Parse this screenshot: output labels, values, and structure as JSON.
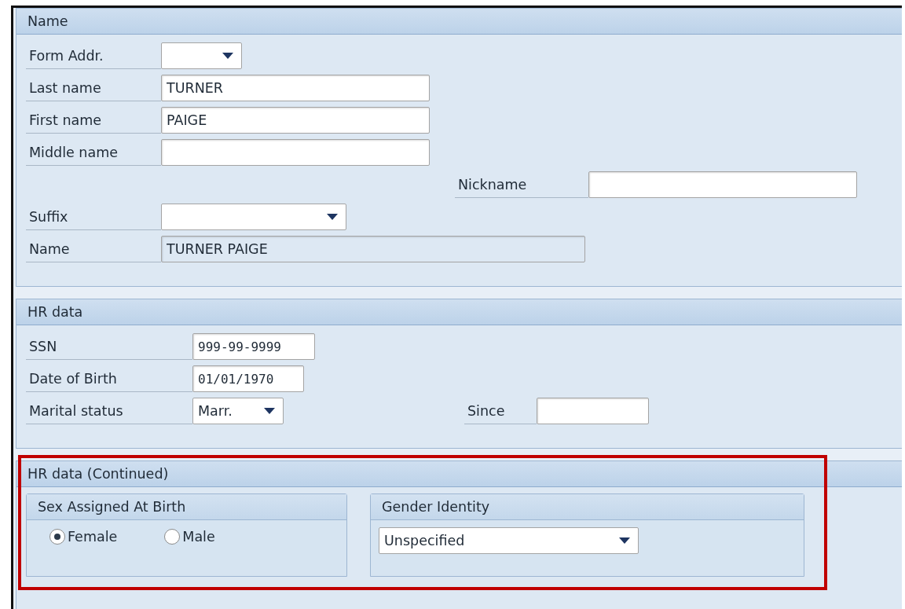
{
  "sections": [
    {
      "title": "Name",
      "rows": [
        [
          {
            "label": "Form Addr.",
            "kind": "dropdown"
          }
        ],
        [
          {
            "label": "Last name",
            "kind": "text",
            "value": "TURNER"
          }
        ],
        [
          {
            "label": "First name",
            "kind": "text",
            "value": "PAIGE"
          }
        ],
        [
          {
            "label": "Middle name",
            "kind": "text"
          }
        ],
        [
          {
            "label": "Nickname",
            "kind": "text"
          }
        ],
        [
          {
            "label": "Suffix",
            "kind": "dropdown"
          }
        ],
        [
          {
            "label": "Name",
            "kind": "readonly",
            "value": "TURNER PAIGE"
          }
        ]
      ]
    },
    {
      "title": "HR data",
      "rows": [
        [
          {
            "label": "SSN",
            "kind": "mono",
            "value": "999-99-9999"
          }
        ],
        [
          {
            "label": "Date of Birth",
            "kind": "mono",
            "value": "01/01/1970"
          }
        ],
        [
          {
            "label": "Marital status",
            "kind": "dropdown",
            "value": "Marr."
          },
          {
            "label": "Since",
            "kind": "text"
          }
        ]
      ]
    },
    {
      "title": "HR data (Continued)",
      "highlighted": true,
      "sex_assigned_at_birth": {
        "title": "Sex Assigned At Birth",
        "options": [
          {
            "label": "Female",
            "selected": true
          },
          {
            "label": "Male",
            "selected": false
          }
        ]
      },
      "gender_identity": {
        "title": "Gender Identity",
        "dropdown": {
          "value": "Unspecified"
        }
      }
    }
  ]
}
